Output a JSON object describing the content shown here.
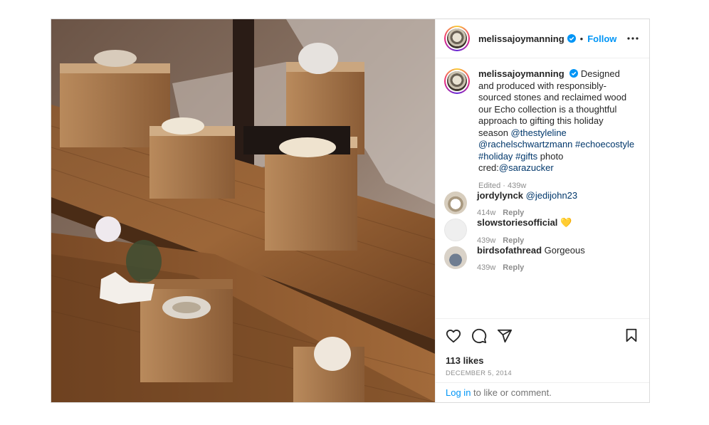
{
  "post": {
    "author": {
      "username": "melissajoymanning",
      "verified": true,
      "follow_label": "Follow",
      "separator": "•"
    },
    "caption": {
      "username": "melissajoymanning",
      "text": "Designed and produced with responsibly-sourced stones and reclaimed wood our Echo collection is a thoughtful approach to gifting this holiday season",
      "mentions_tags": [
        "@thestyleline",
        "@rachelschwartzmann",
        "#echoecostyle",
        "#holiday",
        "#gifts"
      ],
      "photo_cred_label": "photo cred:",
      "photo_cred_user": "@sarazucker",
      "edited_label": "Edited",
      "meta_dot": "·",
      "time": "439w"
    },
    "comments": [
      {
        "username": "jordylynck",
        "text": "@jedijohn23",
        "time": "414w",
        "reply_label": "Reply",
        "avatar_color": "#d7cdbd"
      },
      {
        "username": "slowstoriesofficial",
        "text": "💛",
        "time": "439w",
        "reply_label": "Reply",
        "avatar_color": "#efefef"
      },
      {
        "username": "birdsofathread",
        "text": "Gorgeous",
        "time": "439w",
        "reply_label": "Reply",
        "avatar_color": "#b7b3ad"
      }
    ],
    "likes": "113 likes",
    "date": "DECEMBER 5, 2014",
    "login_link": "Log in",
    "login_rest": " to like or comment."
  },
  "icons": [
    "more-icon",
    "verified-badge-icon",
    "like-heart-icon",
    "comment-icon",
    "share-icon",
    "bookmark-icon"
  ],
  "colors": {
    "accent": "#0095f6",
    "link": "#00376b",
    "muted": "#8e8e8e",
    "border": "#dbdbdb"
  }
}
